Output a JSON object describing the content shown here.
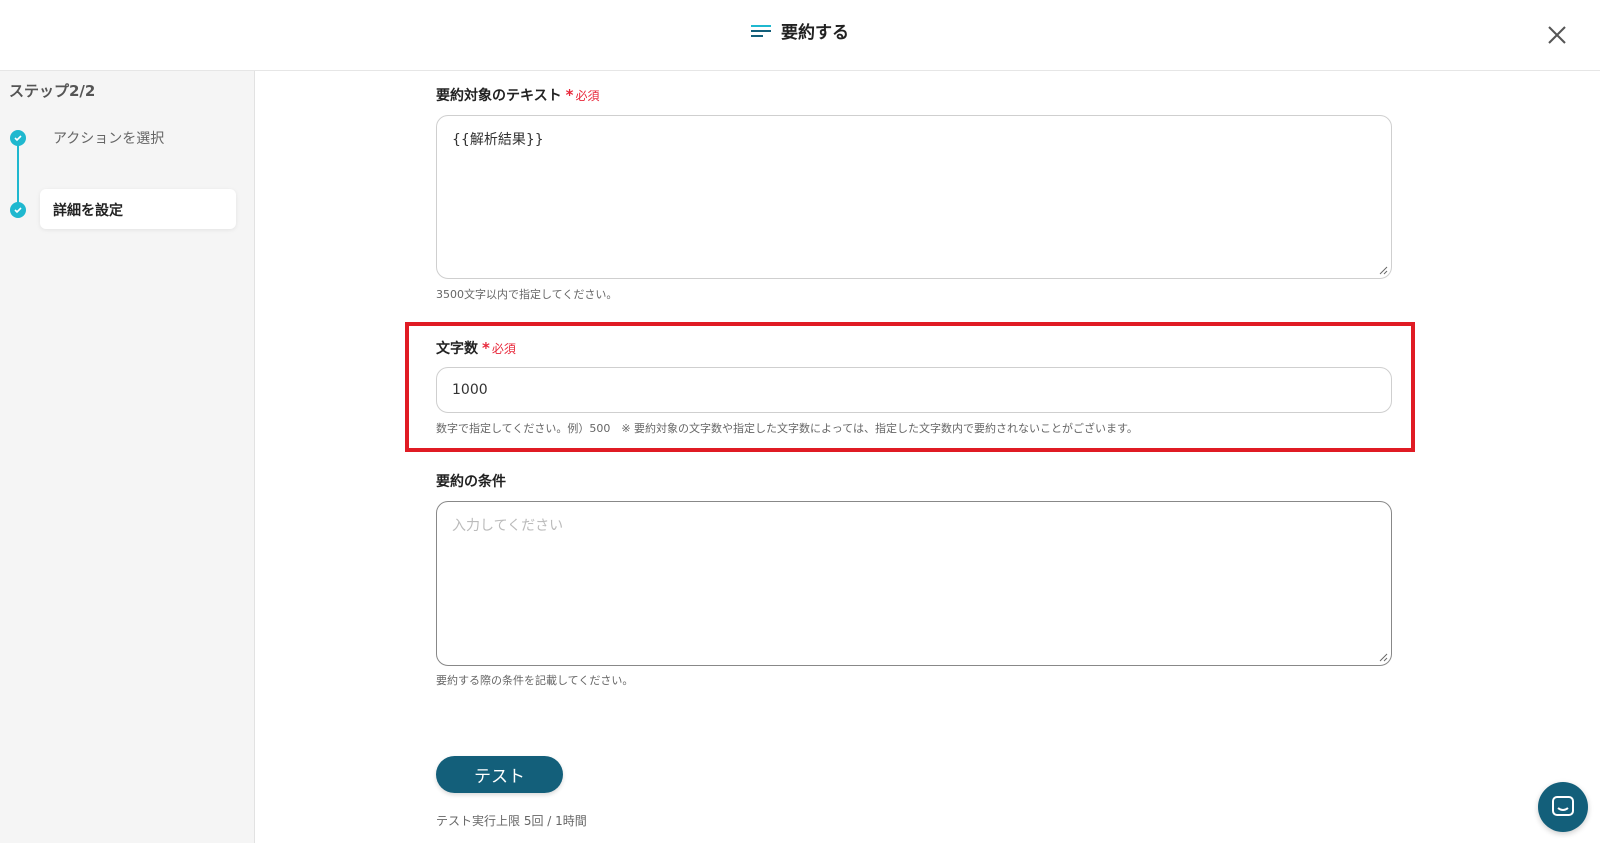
{
  "header": {
    "title": "要約する"
  },
  "sidebar": {
    "step_count": "ステップ2/2",
    "steps": [
      {
        "label": "アクションを選択",
        "done": true
      },
      {
        "label": "詳細を設定",
        "done": true,
        "active": true
      }
    ]
  },
  "form": {
    "text_field": {
      "label": "要約対象のテキスト",
      "required": "必須",
      "value": "{{解析結果}}",
      "help": "3500文字以内で指定してください。"
    },
    "char_count_field": {
      "label": "文字数",
      "required": "必須",
      "value": "1000",
      "help": "数字で指定してください。例）500　※ 要約対象の文字数や指定した文字数によっては、指定した文字数内で要約されないことがございます。"
    },
    "condition_field": {
      "label": "要約の条件",
      "placeholder": "入力してください",
      "help": "要約する際の条件を記載してください。"
    }
  },
  "actions": {
    "test_label": "テスト",
    "test_note": "テスト実行上限 5回 / 1時間"
  },
  "colors": {
    "accent": "#1fb8cf",
    "primary": "#135f7a",
    "required": "#e8283b",
    "highlight": "#e01b24"
  }
}
